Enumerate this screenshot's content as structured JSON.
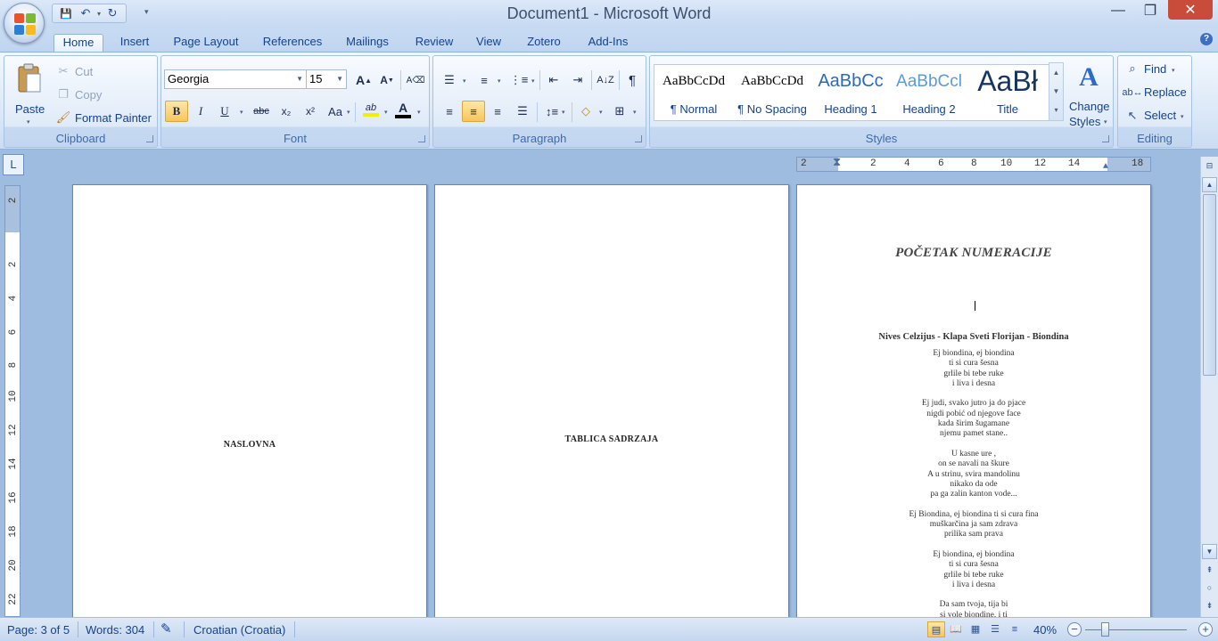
{
  "window": {
    "title": "Document1 - Microsoft Word",
    "minimize": "—",
    "maximize": "❐",
    "close": "✕"
  },
  "quick_access": {
    "save": "💾",
    "undo": "↶",
    "redo": "↻",
    "more": "▾"
  },
  "tabs": [
    "Home",
    "Insert",
    "Page Layout",
    "References",
    "Mailings",
    "Review",
    "View",
    "Zotero",
    "Add-Ins"
  ],
  "active_tab": "Home",
  "help_label": "?",
  "clipboard": {
    "label": "Clipboard",
    "paste": "Paste",
    "cut": "Cut",
    "copy": "Copy",
    "format_painter": "Format Painter"
  },
  "font": {
    "label": "Font",
    "name": "Georgia",
    "size": "15",
    "grow": "A",
    "shrink": "A",
    "bold": "B",
    "italic": "I",
    "underline": "U",
    "strike": "abc",
    "subscript": "x₂",
    "superscript": "x²",
    "change_case": "Aa",
    "highlight": "ab",
    "font_color": "A",
    "highlight_color": "#f5ec00",
    "font_color_value": "#c00000"
  },
  "paragraph": {
    "label": "Paragraph"
  },
  "styles": {
    "label": "Styles",
    "items": [
      {
        "preview": "AaBbCcDd",
        "name": "¶ Normal"
      },
      {
        "preview": "AaBbCcDd",
        "name": "¶ No Spacing"
      },
      {
        "preview": "AaBbCc",
        "name": "Heading 1"
      },
      {
        "preview": "AaBbCcl",
        "name": "Heading 2"
      },
      {
        "preview": "AaBł",
        "name": "Title"
      }
    ],
    "change_styles_line1": "Change",
    "change_styles_line2": "Styles"
  },
  "editing": {
    "label": "Editing",
    "find": "Find",
    "replace": "Replace",
    "select": "Select"
  },
  "ruler": {
    "horizontal_ticks": [
      "2",
      "2",
      "4",
      "6",
      "8",
      "10",
      "12",
      "14",
      "",
      "18"
    ],
    "vertical_ticks": [
      "2",
      "2",
      "4",
      "6",
      "8",
      "10",
      "12",
      "14",
      "16",
      "18",
      "20",
      "22"
    ]
  },
  "pages": {
    "page1_title": "NASLOVNA",
    "page2_title": "TABLICA SADRZAJA",
    "page3_title": "POČETAK NUMERACIJE",
    "song_title": "Nives Celzijus - Klapa Sveti Florijan - Biondina",
    "lyrics": [
      [
        "Ej biondina, ej biondina",
        "ti si cura šesna",
        "grlile bi tebe ruke",
        "i liva i desna"
      ],
      [
        "Ej judi, svako jutro ja do pjace",
        "nigdi pobić od njegove face",
        "kada širim šugamane",
        "njemu pamet stane.."
      ],
      [
        "U kasne ure ,",
        "on se navali na škure",
        "A u strinu, svira mandolinu",
        "nikako da ode",
        "pa ga zalin kanton vode..."
      ],
      [
        "Ej Biondina, ej biondina ti si cura fina",
        "muškarčina ja sam zdrava",
        "prilika sam prava"
      ],
      [
        "Ej biondina, ej biondina",
        "ti si cura šesna",
        "grlile bi tebe ruke",
        "i liva i desna"
      ],
      [
        "Da sam tvoja, tija bi",
        "si vole biondine, i ti"
      ]
    ]
  },
  "statusbar": {
    "page": "Page: 3 of 5",
    "words": "Words: 304",
    "language": "Croatian (Croatia)",
    "zoom": "40%",
    "zoom_level": 0.4
  }
}
